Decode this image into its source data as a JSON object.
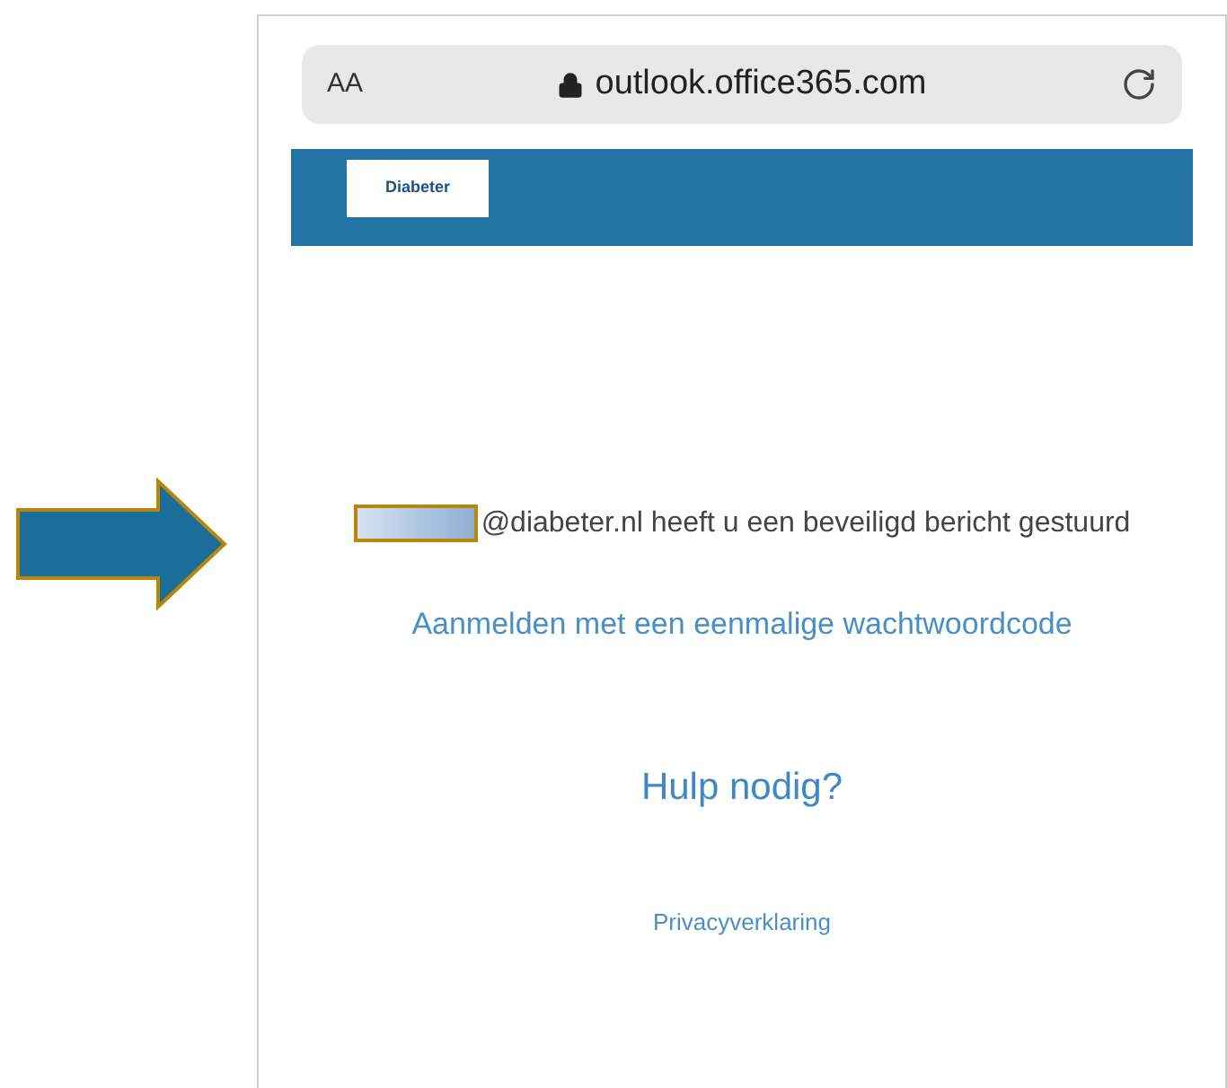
{
  "browser_bar": {
    "text_size_label": "AA",
    "url": "outlook.office365.com"
  },
  "header": {
    "logo_text": "Diabeter"
  },
  "message": {
    "redacted": true,
    "text": "@diabeter.nl heeft u een beveiligd bericht gestuurd"
  },
  "otp_link": "Aanmelden met een eenmalige wachtwoordcode",
  "help_link": "Hulp nodig?",
  "privacy_link": "Privacyverklaring"
}
